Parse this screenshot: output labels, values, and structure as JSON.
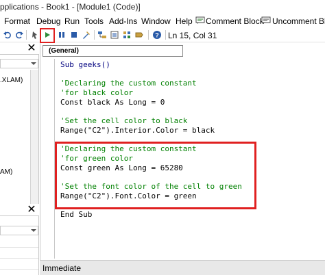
{
  "window": {
    "title": "pplications - Book1 - [Module1 (Code)]"
  },
  "menu": {
    "items": [
      "Format",
      "Debug",
      "Run",
      "Tools",
      "Add-Ins",
      "Window",
      "Help"
    ],
    "comment_block": "Comment Block",
    "uncomment_block": "Uncomment Block"
  },
  "toolbar": {
    "status": "Ln 15, Col 31",
    "icons": [
      "undo-icon",
      "redo-icon",
      "run-icon",
      "break-icon",
      "reset-icon",
      "design-mode-icon",
      "project-explorer-icon",
      "properties-icon",
      "object-browser-icon",
      "toolbox-icon",
      "help-icon"
    ],
    "highlight_color": "#e02020"
  },
  "project_pane": {
    "items": [
      ".XLAM)",
      "AM)"
    ]
  },
  "code_window": {
    "object_dropdown": "(General)",
    "lines": [
      {
        "parts": [
          {
            "t": "Sub geeks()",
            "c": "kw"
          }
        ]
      },
      {
        "parts": []
      },
      {
        "parts": [
          {
            "t": "'Declaring the custom constant",
            "c": "cm"
          }
        ]
      },
      {
        "parts": [
          {
            "t": "'for black color",
            "c": "cm"
          }
        ]
      },
      {
        "parts": [
          {
            "t": "Const black As Long = 0",
            "c": ""
          }
        ]
      },
      {
        "parts": []
      },
      {
        "parts": [
          {
            "t": "'Set the cell color to black",
            "c": "cm"
          }
        ]
      },
      {
        "parts": [
          {
            "t": "Range(\"C2\").Interior.Color = black",
            "c": ""
          }
        ]
      },
      {
        "parts": []
      },
      {
        "parts": [
          {
            "t": "'Declaring the custom constant",
            "c": "cm"
          }
        ]
      },
      {
        "parts": [
          {
            "t": "'for green color",
            "c": "cm"
          }
        ]
      },
      {
        "parts": [
          {
            "t": "Const green As Long = 65280",
            "c": ""
          }
        ]
      },
      {
        "parts": []
      },
      {
        "parts": [
          {
            "t": "'Set the font color of the cell to green",
            "c": "cm"
          }
        ]
      },
      {
        "parts": [
          {
            "t": "Range(\"C2\").Font.Color = green",
            "c": ""
          }
        ]
      },
      {
        "parts": []
      },
      {
        "parts": [
          {
            "t": "End Sub",
            "c": ""
          }
        ]
      }
    ],
    "comment_color": "#008000",
    "highlight_color": "#e02020"
  },
  "immediate": {
    "label": "Immediate"
  }
}
